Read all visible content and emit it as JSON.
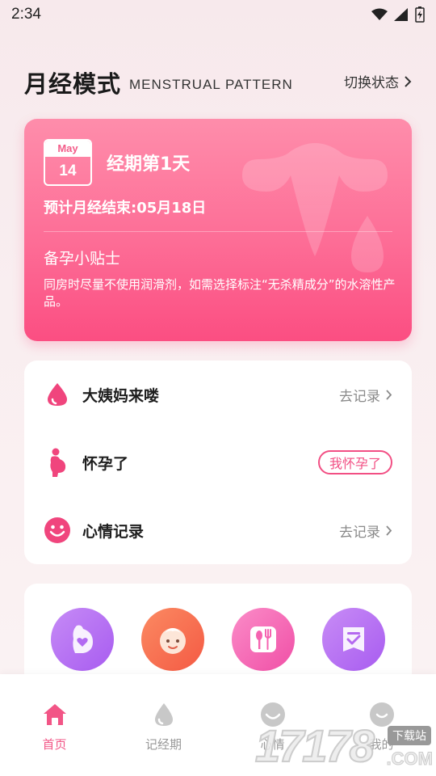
{
  "status_bar": {
    "time": "2:34"
  },
  "header": {
    "title": "月经模式",
    "subtitle": "MENSTRUAL PATTERN",
    "switch_label": "切换状态"
  },
  "hero": {
    "month": "May",
    "day": "14",
    "period_day": "经期第1天",
    "period_end": "预计月经结束:05月18日",
    "tip_title": "备孕小贴士",
    "tip_text": "同房时尽量不使用润滑剂，如需选择标注“无杀精成分”的水溶性产品。"
  },
  "actions": {
    "period": {
      "label": "大姨妈来喽",
      "action": "去记录",
      "icon": "blood-drop-icon"
    },
    "pregnant": {
      "label": "怀孕了",
      "action": "我怀孕了",
      "icon": "pregnant-woman-icon"
    },
    "mood": {
      "label": "心情记录",
      "action": "去记录",
      "icon": "smiley-icon"
    }
  },
  "tools": [
    {
      "icon": "pregnancy-heart-icon",
      "color": "#b26af2"
    },
    {
      "icon": "baby-face-icon",
      "color": "#f86a4e"
    },
    {
      "icon": "food-icon",
      "color": "#f563b0"
    },
    {
      "icon": "checklist-icon",
      "color": "#b469f0"
    }
  ],
  "tabs": [
    {
      "label": "首页",
      "icon": "home-icon",
      "active": true
    },
    {
      "label": "记经期",
      "icon": "drop-icon",
      "active": false
    },
    {
      "label": "心情",
      "icon": "mood-icon",
      "active": false
    },
    {
      "label": "我的",
      "icon": "profile-icon",
      "active": false
    }
  ],
  "colors": {
    "accent": "#f25586",
    "card_top": "#fe8dab",
    "card_bottom": "#fb4e82"
  },
  "watermark": {
    "text": "17178",
    "badge": "下载站",
    "suffix": ".COM"
  }
}
